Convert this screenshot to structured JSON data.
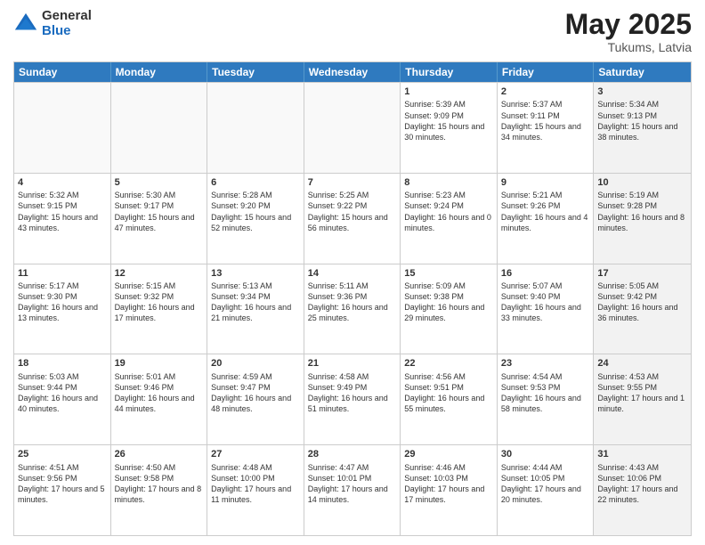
{
  "header": {
    "logo_general": "General",
    "logo_blue": "Blue",
    "month_year": "May 2025",
    "location": "Tukums, Latvia"
  },
  "days": [
    "Sunday",
    "Monday",
    "Tuesday",
    "Wednesday",
    "Thursday",
    "Friday",
    "Saturday"
  ],
  "rows": [
    [
      {
        "day": "",
        "text": "",
        "empty": true
      },
      {
        "day": "",
        "text": "",
        "empty": true
      },
      {
        "day": "",
        "text": "",
        "empty": true
      },
      {
        "day": "",
        "text": "",
        "empty": true
      },
      {
        "day": "1",
        "text": "Sunrise: 5:39 AM\nSunset: 9:09 PM\nDaylight: 15 hours\nand 30 minutes."
      },
      {
        "day": "2",
        "text": "Sunrise: 5:37 AM\nSunset: 9:11 PM\nDaylight: 15 hours\nand 34 minutes."
      },
      {
        "day": "3",
        "text": "Sunrise: 5:34 AM\nSunset: 9:13 PM\nDaylight: 15 hours\nand 38 minutes.",
        "alt": true
      }
    ],
    [
      {
        "day": "4",
        "text": "Sunrise: 5:32 AM\nSunset: 9:15 PM\nDaylight: 15 hours\nand 43 minutes."
      },
      {
        "day": "5",
        "text": "Sunrise: 5:30 AM\nSunset: 9:17 PM\nDaylight: 15 hours\nand 47 minutes."
      },
      {
        "day": "6",
        "text": "Sunrise: 5:28 AM\nSunset: 9:20 PM\nDaylight: 15 hours\nand 52 minutes."
      },
      {
        "day": "7",
        "text": "Sunrise: 5:25 AM\nSunset: 9:22 PM\nDaylight: 15 hours\nand 56 minutes."
      },
      {
        "day": "8",
        "text": "Sunrise: 5:23 AM\nSunset: 9:24 PM\nDaylight: 16 hours\nand 0 minutes."
      },
      {
        "day": "9",
        "text": "Sunrise: 5:21 AM\nSunset: 9:26 PM\nDaylight: 16 hours\nand 4 minutes."
      },
      {
        "day": "10",
        "text": "Sunrise: 5:19 AM\nSunset: 9:28 PM\nDaylight: 16 hours\nand 8 minutes.",
        "alt": true
      }
    ],
    [
      {
        "day": "11",
        "text": "Sunrise: 5:17 AM\nSunset: 9:30 PM\nDaylight: 16 hours\nand 13 minutes."
      },
      {
        "day": "12",
        "text": "Sunrise: 5:15 AM\nSunset: 9:32 PM\nDaylight: 16 hours\nand 17 minutes."
      },
      {
        "day": "13",
        "text": "Sunrise: 5:13 AM\nSunset: 9:34 PM\nDaylight: 16 hours\nand 21 minutes."
      },
      {
        "day": "14",
        "text": "Sunrise: 5:11 AM\nSunset: 9:36 PM\nDaylight: 16 hours\nand 25 minutes."
      },
      {
        "day": "15",
        "text": "Sunrise: 5:09 AM\nSunset: 9:38 PM\nDaylight: 16 hours\nand 29 minutes."
      },
      {
        "day": "16",
        "text": "Sunrise: 5:07 AM\nSunset: 9:40 PM\nDaylight: 16 hours\nand 33 minutes."
      },
      {
        "day": "17",
        "text": "Sunrise: 5:05 AM\nSunset: 9:42 PM\nDaylight: 16 hours\nand 36 minutes.",
        "alt": true
      }
    ],
    [
      {
        "day": "18",
        "text": "Sunrise: 5:03 AM\nSunset: 9:44 PM\nDaylight: 16 hours\nand 40 minutes."
      },
      {
        "day": "19",
        "text": "Sunrise: 5:01 AM\nSunset: 9:46 PM\nDaylight: 16 hours\nand 44 minutes."
      },
      {
        "day": "20",
        "text": "Sunrise: 4:59 AM\nSunset: 9:47 PM\nDaylight: 16 hours\nand 48 minutes."
      },
      {
        "day": "21",
        "text": "Sunrise: 4:58 AM\nSunset: 9:49 PM\nDaylight: 16 hours\nand 51 minutes."
      },
      {
        "day": "22",
        "text": "Sunrise: 4:56 AM\nSunset: 9:51 PM\nDaylight: 16 hours\nand 55 minutes."
      },
      {
        "day": "23",
        "text": "Sunrise: 4:54 AM\nSunset: 9:53 PM\nDaylight: 16 hours\nand 58 minutes."
      },
      {
        "day": "24",
        "text": "Sunrise: 4:53 AM\nSunset: 9:55 PM\nDaylight: 17 hours\nand 1 minute.",
        "alt": true
      }
    ],
    [
      {
        "day": "25",
        "text": "Sunrise: 4:51 AM\nSunset: 9:56 PM\nDaylight: 17 hours\nand 5 minutes."
      },
      {
        "day": "26",
        "text": "Sunrise: 4:50 AM\nSunset: 9:58 PM\nDaylight: 17 hours\nand 8 minutes."
      },
      {
        "day": "27",
        "text": "Sunrise: 4:48 AM\nSunset: 10:00 PM\nDaylight: 17 hours\nand 11 minutes."
      },
      {
        "day": "28",
        "text": "Sunrise: 4:47 AM\nSunset: 10:01 PM\nDaylight: 17 hours\nand 14 minutes."
      },
      {
        "day": "29",
        "text": "Sunrise: 4:46 AM\nSunset: 10:03 PM\nDaylight: 17 hours\nand 17 minutes."
      },
      {
        "day": "30",
        "text": "Sunrise: 4:44 AM\nSunset: 10:05 PM\nDaylight: 17 hours\nand 20 minutes."
      },
      {
        "day": "31",
        "text": "Sunrise: 4:43 AM\nSunset: 10:06 PM\nDaylight: 17 hours\nand 22 minutes.",
        "alt": true
      }
    ]
  ]
}
